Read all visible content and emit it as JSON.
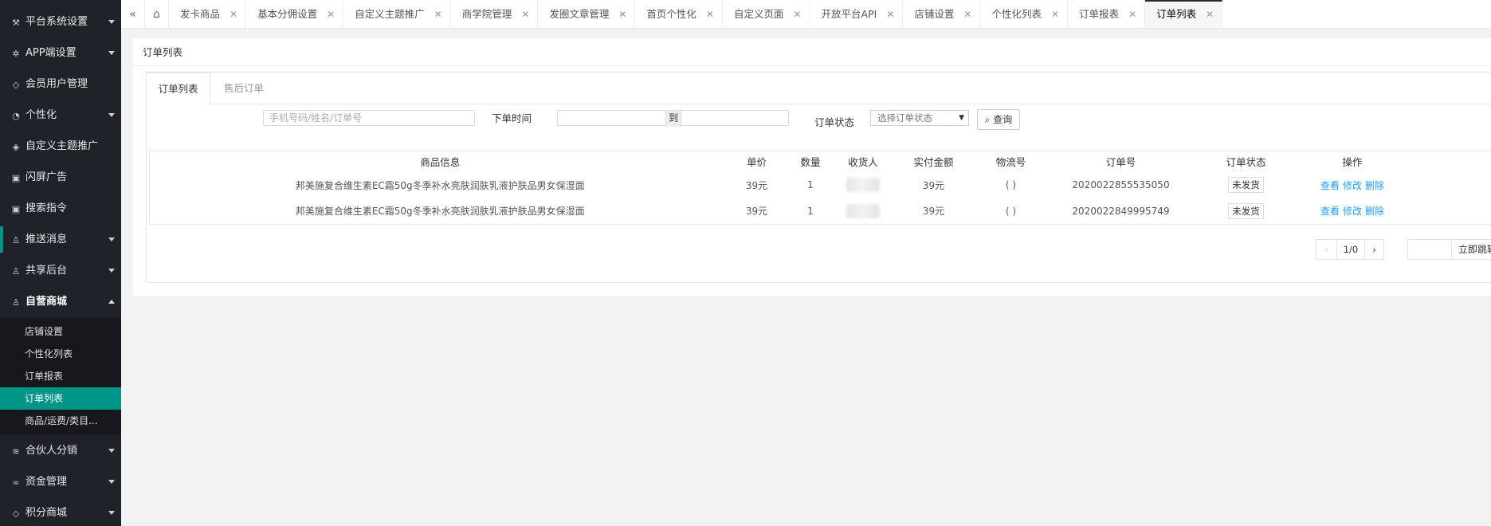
{
  "sidebar": {
    "items": [
      {
        "label": "平台系统设置",
        "icon": "tools-icon",
        "glyph": "⚒"
      },
      {
        "label": "APP端设置",
        "icon": "gear-icon",
        "glyph": "✲"
      },
      {
        "label": "会员用户管理",
        "icon": "shield-icon",
        "glyph": "◇"
      },
      {
        "label": "个性化",
        "icon": "palette-icon",
        "glyph": "◔"
      },
      {
        "label": "自定义主题推广",
        "icon": "box-icon",
        "glyph": "◈"
      },
      {
        "label": "闪屏广告",
        "icon": "image-icon",
        "glyph": "▣"
      },
      {
        "label": "搜索指令",
        "icon": "image-icon",
        "glyph": "▣"
      },
      {
        "label": "推送消息",
        "icon": "user-icon",
        "glyph": "♙"
      },
      {
        "label": "共享后台",
        "icon": "user-icon",
        "glyph": "♙"
      },
      {
        "label": "自营商城",
        "icon": "user-icon",
        "glyph": "♙"
      }
    ],
    "sub_items": [
      "店铺设置",
      "个性化列表",
      "订单报表",
      "订单列表",
      "商品/运费/类目..."
    ],
    "bottom_items": [
      {
        "label": "合伙人分销",
        "icon": "layers-icon",
        "glyph": "≋"
      },
      {
        "label": "资金管理",
        "icon": "link-icon",
        "glyph": "∞"
      },
      {
        "label": "积分商城",
        "icon": "shield-icon",
        "glyph": "◇"
      }
    ]
  },
  "tabbar": {
    "tabs": [
      "发卡商品",
      "基本分佣设置",
      "自定义主题推广",
      "商学院管理",
      "发圈文章管理",
      "首页个性化",
      "自定义页面",
      "开放平台API",
      "店铺设置",
      "个性化列表",
      "订单报表",
      "订单列表"
    ],
    "close_glyph": "✕"
  },
  "panel": {
    "title": "订单列表",
    "tabs": [
      "订单列表",
      "售后订单"
    ]
  },
  "filters": {
    "search_placeholder": "手机号码/姓名/订单号",
    "date_label": "下单时间",
    "date_sep": "到",
    "status_label": "订单状态",
    "status_select": "选择订单状态",
    "query_label": "查询"
  },
  "table": {
    "headers": [
      "商品信息",
      "单价",
      "数量",
      "收货人",
      "实付金额",
      "物流号",
      "订单号",
      "订单状态",
      "操作"
    ],
    "rows": [
      {
        "product": "邦美施复合维生素EC霜50g冬季补水亮肤润肤乳液护肤品男女保湿面",
        "price": "39元",
        "qty": "1",
        "paid": "39元",
        "logistics": "( )",
        "order_no": "2020022855535050",
        "status": "未发货"
      },
      {
        "product": "邦美施复合维生素EC霜50g冬季补水亮肤润肤乳液护肤品男女保湿面",
        "price": "39元",
        "qty": "1",
        "paid": "39元",
        "logistics": "( )",
        "order_no": "2020022849995749",
        "status": "未发货"
      }
    ],
    "actions": [
      "查看",
      "修改",
      "删除"
    ]
  },
  "pager": {
    "page": "1/0",
    "jump_label": "立即跳转"
  }
}
